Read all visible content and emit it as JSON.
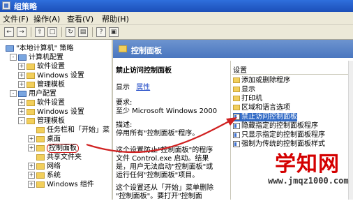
{
  "window": {
    "title": "组策略"
  },
  "menu": [
    "文件(F)",
    "操作(A)",
    "查看(V)",
    "帮助(H)"
  ],
  "toolbar": {
    "buttons": [
      "back",
      "forward",
      "up",
      "properties",
      "refresh",
      "export",
      "help",
      "show-hide"
    ]
  },
  "tree": [
    {
      "label": "\"本地计算机\" 策略",
      "type": "pc",
      "depth": 0,
      "expander": ""
    },
    {
      "label": "计算机配置",
      "type": "pc",
      "depth": 1,
      "expander": "-"
    },
    {
      "label": "软件设置",
      "type": "folder",
      "depth": 2,
      "expander": "+"
    },
    {
      "label": "Windows 设置",
      "type": "folder",
      "depth": 2,
      "expander": "+"
    },
    {
      "label": "管理模板",
      "type": "folder",
      "depth": 2,
      "expander": "+"
    },
    {
      "label": "用户配置",
      "type": "pc",
      "depth": 1,
      "expander": "-"
    },
    {
      "label": "软件设置",
      "type": "folder",
      "depth": 2,
      "expander": "+"
    },
    {
      "label": "Windows 设置",
      "type": "folder",
      "depth": 2,
      "expander": "+"
    },
    {
      "label": "管理模板",
      "type": "folder",
      "depth": 2,
      "expander": "-"
    },
    {
      "label": "任务栏和「开始」菜",
      "type": "folder",
      "depth": 3,
      "expander": ""
    },
    {
      "label": "桌面",
      "type": "folder",
      "depth": 3,
      "expander": "+"
    },
    {
      "label": "控制面板",
      "type": "folder",
      "depth": 3,
      "expander": "+",
      "selected": true
    },
    {
      "label": "共享文件夹",
      "type": "folder",
      "depth": 3,
      "expander": ""
    },
    {
      "label": "网络",
      "type": "folder",
      "depth": 3,
      "expander": "+"
    },
    {
      "label": "系统",
      "type": "folder",
      "depth": 3,
      "expander": "+"
    },
    {
      "label": "Windows 组件",
      "type": "folder",
      "depth": 3,
      "expander": "+"
    }
  ],
  "panel": {
    "title": "控制面板",
    "policy_title": "禁止访问控制面板",
    "show_label": "显示",
    "show_link": "属性",
    "require_label": "要求:",
    "require_text": "至少 Microsoft Windows 2000",
    "desc_label": "描述:",
    "desc_lines": [
      "停用所有\"控制面板\"程序。",
      "这个设置防止\"控制面板\"的程序",
      "文件 Control.exe 启动。结果",
      "是，用户无法启动\"控制面板\"或",
      "运行任何\"控制面板\"项目。",
      "这个设置还从「开始」菜单删除",
      "\"控制面板\"。要打开\"控制面"
    ]
  },
  "settings": {
    "header": "设置",
    "items": [
      {
        "label": "添加或删除程序",
        "type": "folder"
      },
      {
        "label": "显示",
        "type": "folder"
      },
      {
        "label": "打印机",
        "type": "folder"
      },
      {
        "label": "区域和语言选项",
        "type": "folder"
      },
      {
        "label": "禁止访问控制面板",
        "type": "policy",
        "selected": true
      },
      {
        "label": "隐藏指定的控制面板程序",
        "type": "policy"
      },
      {
        "label": "只显示指定的控制面板程序",
        "type": "policy"
      },
      {
        "label": "强制为传统的控制面板样式",
        "type": "policy"
      }
    ]
  },
  "colors": {
    "title_bar": "#1c4fb8",
    "selection": "#316ac5",
    "annotation": "#d02020",
    "watermark": "#d40000"
  },
  "watermark": {
    "text": "学知网",
    "url": "www.jmqz1000.com"
  }
}
